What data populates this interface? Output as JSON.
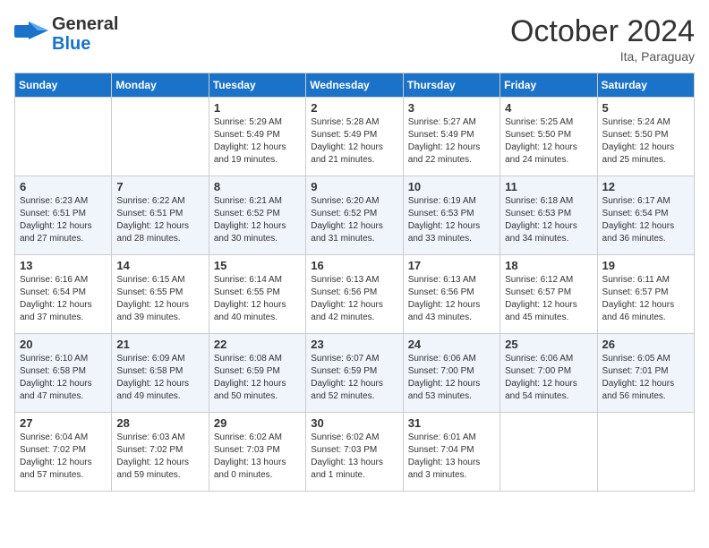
{
  "header": {
    "logo_line1": "General",
    "logo_line2": "Blue",
    "month": "October 2024",
    "location": "Ita, Paraguay"
  },
  "weekdays": [
    "Sunday",
    "Monday",
    "Tuesday",
    "Wednesday",
    "Thursday",
    "Friday",
    "Saturday"
  ],
  "weeks": [
    [
      {
        "day": "",
        "info": ""
      },
      {
        "day": "",
        "info": ""
      },
      {
        "day": "1",
        "info": "Sunrise: 5:29 AM\nSunset: 5:49 PM\nDaylight: 12 hours\nand 19 minutes."
      },
      {
        "day": "2",
        "info": "Sunrise: 5:28 AM\nSunset: 5:49 PM\nDaylight: 12 hours\nand 21 minutes."
      },
      {
        "day": "3",
        "info": "Sunrise: 5:27 AM\nSunset: 5:49 PM\nDaylight: 12 hours\nand 22 minutes."
      },
      {
        "day": "4",
        "info": "Sunrise: 5:25 AM\nSunset: 5:50 PM\nDaylight: 12 hours\nand 24 minutes."
      },
      {
        "day": "5",
        "info": "Sunrise: 5:24 AM\nSunset: 5:50 PM\nDaylight: 12 hours\nand 25 minutes."
      }
    ],
    [
      {
        "day": "6",
        "info": "Sunrise: 6:23 AM\nSunset: 6:51 PM\nDaylight: 12 hours\nand 27 minutes."
      },
      {
        "day": "7",
        "info": "Sunrise: 6:22 AM\nSunset: 6:51 PM\nDaylight: 12 hours\nand 28 minutes."
      },
      {
        "day": "8",
        "info": "Sunrise: 6:21 AM\nSunset: 6:52 PM\nDaylight: 12 hours\nand 30 minutes."
      },
      {
        "day": "9",
        "info": "Sunrise: 6:20 AM\nSunset: 6:52 PM\nDaylight: 12 hours\nand 31 minutes."
      },
      {
        "day": "10",
        "info": "Sunrise: 6:19 AM\nSunset: 6:53 PM\nDaylight: 12 hours\nand 33 minutes."
      },
      {
        "day": "11",
        "info": "Sunrise: 6:18 AM\nSunset: 6:53 PM\nDaylight: 12 hours\nand 34 minutes."
      },
      {
        "day": "12",
        "info": "Sunrise: 6:17 AM\nSunset: 6:54 PM\nDaylight: 12 hours\nand 36 minutes."
      }
    ],
    [
      {
        "day": "13",
        "info": "Sunrise: 6:16 AM\nSunset: 6:54 PM\nDaylight: 12 hours\nand 37 minutes."
      },
      {
        "day": "14",
        "info": "Sunrise: 6:15 AM\nSunset: 6:55 PM\nDaylight: 12 hours\nand 39 minutes."
      },
      {
        "day": "15",
        "info": "Sunrise: 6:14 AM\nSunset: 6:55 PM\nDaylight: 12 hours\nand 40 minutes."
      },
      {
        "day": "16",
        "info": "Sunrise: 6:13 AM\nSunset: 6:56 PM\nDaylight: 12 hours\nand 42 minutes."
      },
      {
        "day": "17",
        "info": "Sunrise: 6:13 AM\nSunset: 6:56 PM\nDaylight: 12 hours\nand 43 minutes."
      },
      {
        "day": "18",
        "info": "Sunrise: 6:12 AM\nSunset: 6:57 PM\nDaylight: 12 hours\nand 45 minutes."
      },
      {
        "day": "19",
        "info": "Sunrise: 6:11 AM\nSunset: 6:57 PM\nDaylight: 12 hours\nand 46 minutes."
      }
    ],
    [
      {
        "day": "20",
        "info": "Sunrise: 6:10 AM\nSunset: 6:58 PM\nDaylight: 12 hours\nand 47 minutes."
      },
      {
        "day": "21",
        "info": "Sunrise: 6:09 AM\nSunset: 6:58 PM\nDaylight: 12 hours\nand 49 minutes."
      },
      {
        "day": "22",
        "info": "Sunrise: 6:08 AM\nSunset: 6:59 PM\nDaylight: 12 hours\nand 50 minutes."
      },
      {
        "day": "23",
        "info": "Sunrise: 6:07 AM\nSunset: 6:59 PM\nDaylight: 12 hours\nand 52 minutes."
      },
      {
        "day": "24",
        "info": "Sunrise: 6:06 AM\nSunset: 7:00 PM\nDaylight: 12 hours\nand 53 minutes."
      },
      {
        "day": "25",
        "info": "Sunrise: 6:06 AM\nSunset: 7:00 PM\nDaylight: 12 hours\nand 54 minutes."
      },
      {
        "day": "26",
        "info": "Sunrise: 6:05 AM\nSunset: 7:01 PM\nDaylight: 12 hours\nand 56 minutes."
      }
    ],
    [
      {
        "day": "27",
        "info": "Sunrise: 6:04 AM\nSunset: 7:02 PM\nDaylight: 12 hours\nand 57 minutes."
      },
      {
        "day": "28",
        "info": "Sunrise: 6:03 AM\nSunset: 7:02 PM\nDaylight: 12 hours\nand 59 minutes."
      },
      {
        "day": "29",
        "info": "Sunrise: 6:02 AM\nSunset: 7:03 PM\nDaylight: 13 hours\nand 0 minutes."
      },
      {
        "day": "30",
        "info": "Sunrise: 6:02 AM\nSunset: 7:03 PM\nDaylight: 13 hours\nand 1 minute."
      },
      {
        "day": "31",
        "info": "Sunrise: 6:01 AM\nSunset: 7:04 PM\nDaylight: 13 hours\nand 3 minutes."
      },
      {
        "day": "",
        "info": ""
      },
      {
        "day": "",
        "info": ""
      }
    ]
  ]
}
